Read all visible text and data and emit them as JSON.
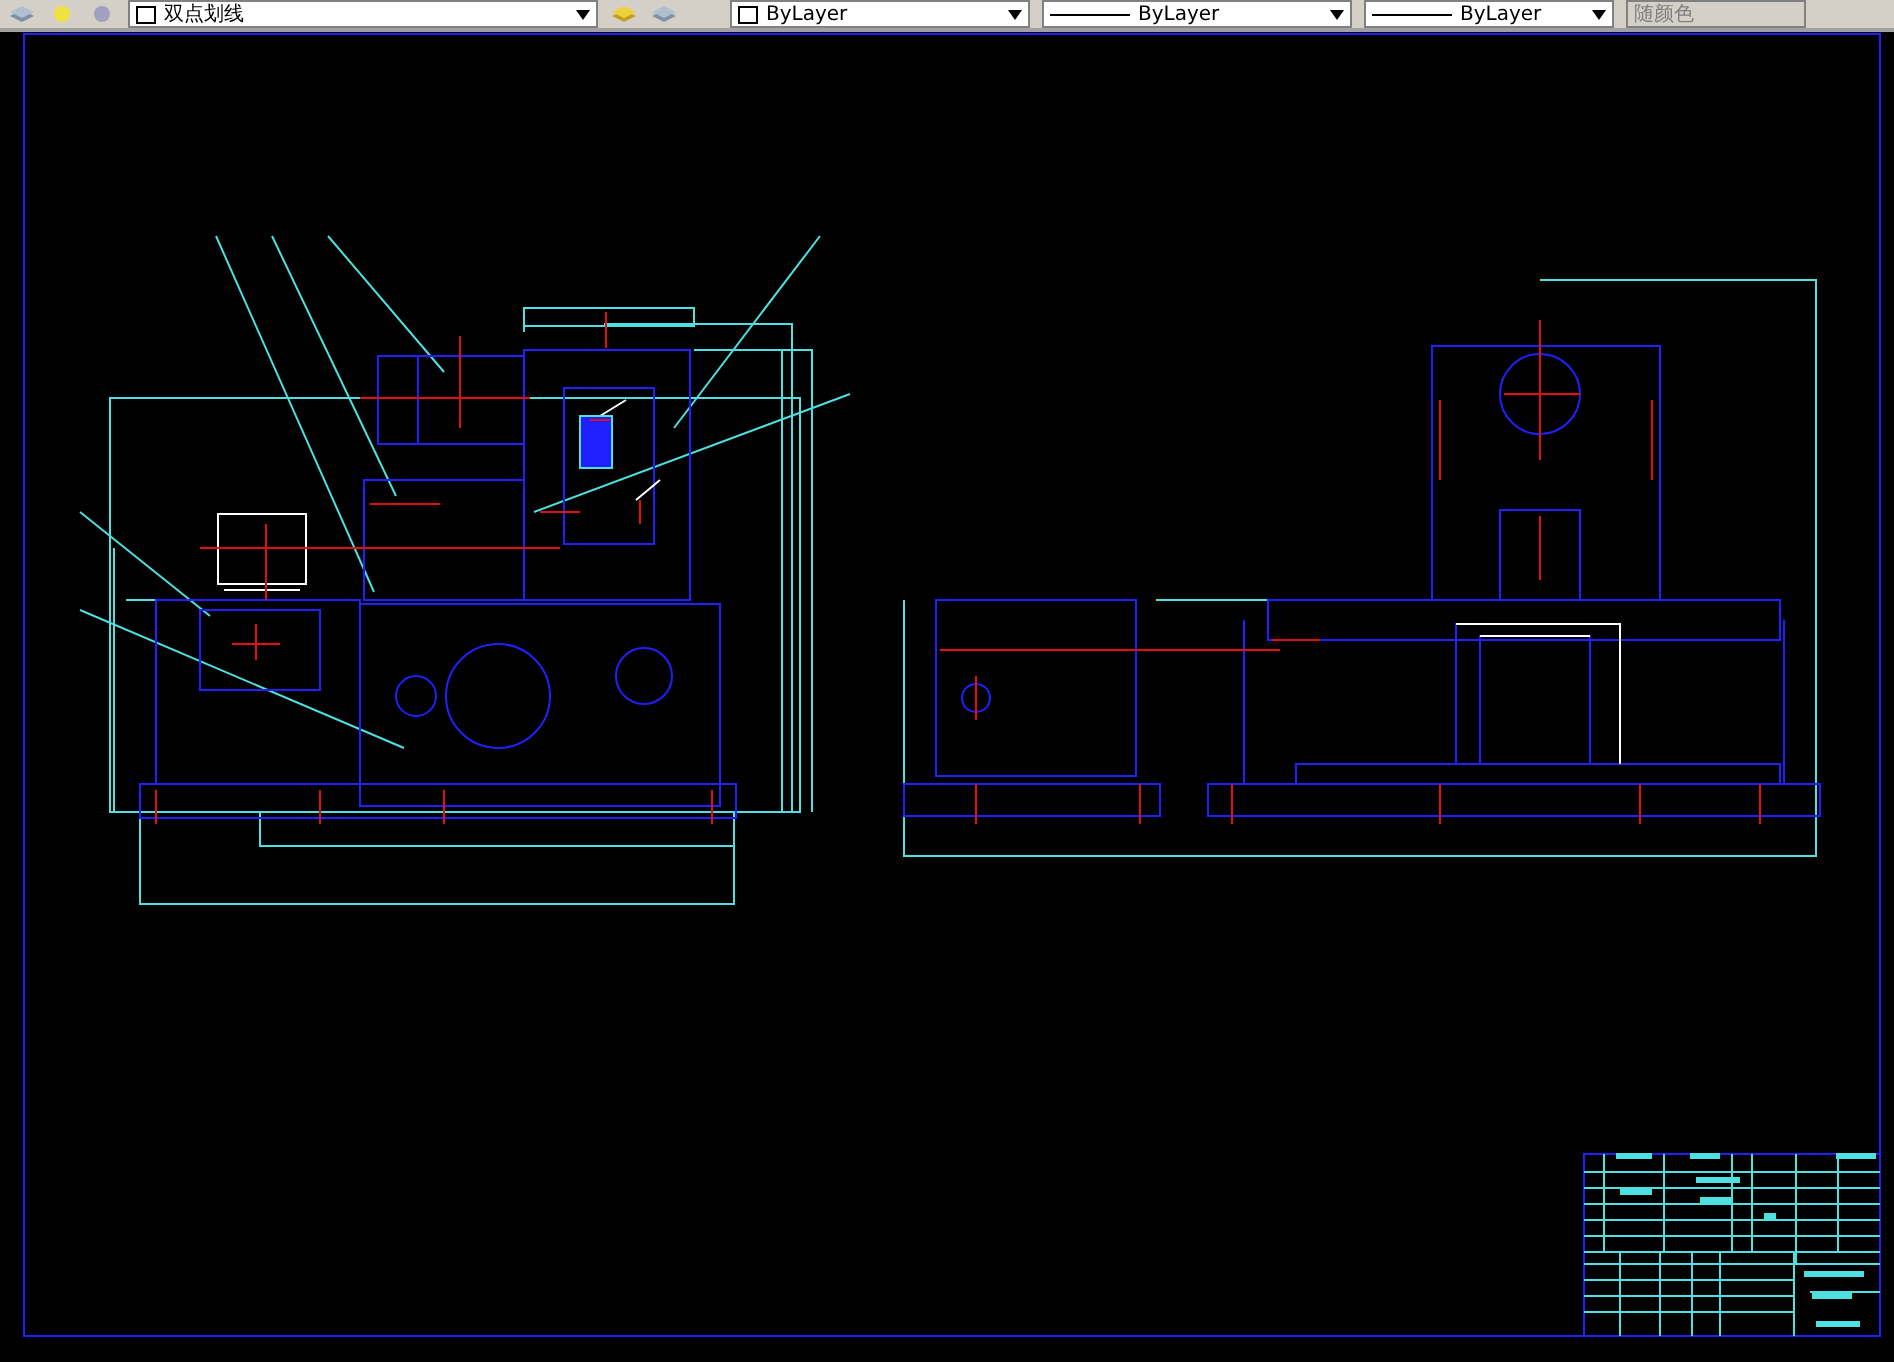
{
  "toolbar": {
    "layer": {
      "name": "双点划线"
    },
    "color": {
      "value": "ByLayer"
    },
    "linetype": {
      "value": "ByLayer"
    },
    "lineweight": {
      "value": "ByLayer"
    },
    "plot_style": {
      "value": "随颜色",
      "disabled": true
    }
  }
}
